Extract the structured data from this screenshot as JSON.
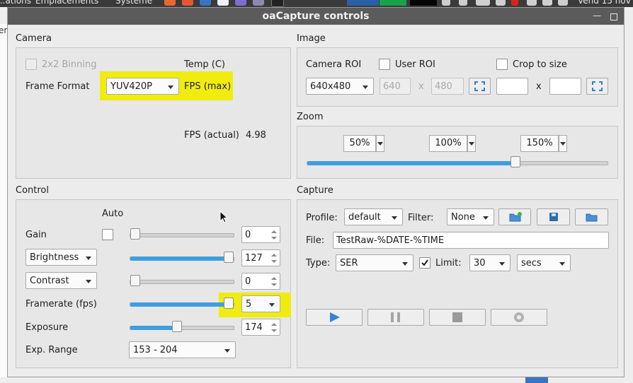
{
  "topbar": {
    "menus": [
      "...ations",
      "Emplacements",
      "Système"
    ],
    "clock": "Vend 15 nov"
  },
  "behind": {
    "partial_text": "er"
  },
  "window": {
    "title": "oaCapture controls"
  },
  "camera": {
    "title": "Camera",
    "binning_label": "2x2 Binning",
    "temp_label": "Temp (C)",
    "frame_format_label": "Frame Format",
    "frame_format_value": "YUV420P",
    "fps_max_label": "FPS (max)",
    "fps_actual_label": "FPS (actual)",
    "fps_actual_value": "4.98"
  },
  "image": {
    "title": "Image",
    "roi_label": "Camera ROI",
    "user_roi_label": "User ROI",
    "crop_label": "Crop to size",
    "roi_value": "640x480",
    "roi_w": "640",
    "roi_h": "480",
    "x_sep": "x"
  },
  "zoom": {
    "title": "Zoom",
    "z1": "50%",
    "z2": "100%",
    "z3": "150%",
    "level": 0.7
  },
  "control": {
    "title": "Control",
    "auto_label": "Auto",
    "gain": {
      "label": "Gain",
      "value": "0",
      "level": 0
    },
    "brightness": {
      "label": "Brightness",
      "value": "127",
      "level": 1
    },
    "contrast": {
      "label": "Contrast",
      "value": "0",
      "level": 0
    },
    "framerate": {
      "label": "Framerate (fps)",
      "value": "5",
      "level": 1
    },
    "exposure": {
      "label": "Exposure",
      "value": "174",
      "level": 0.45
    },
    "exp_range": {
      "label": "Exp. Range",
      "value": "153 - 204"
    }
  },
  "capture": {
    "title": "Capture",
    "profile_label": "Profile:",
    "profile_value": "default",
    "filter_label": "Filter:",
    "filter_value": "None",
    "file_label": "File:",
    "file_value": "TestRaw-%DATE-%TIME",
    "type_label": "Type:",
    "type_value": "SER",
    "limit_label": "Limit:",
    "limit_value": "30",
    "limit_unit": "secs"
  },
  "colors": {
    "highlight": "#f1ec10",
    "accent": "#3d9ee0",
    "titlebar": "#5b5b5b"
  }
}
